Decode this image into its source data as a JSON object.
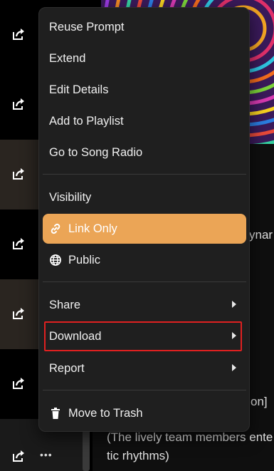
{
  "menu": {
    "items": [
      {
        "label": "Reuse Prompt"
      },
      {
        "label": "Extend"
      },
      {
        "label": "Edit Details"
      },
      {
        "label": "Add to Playlist"
      },
      {
        "label": "Go to Song Radio"
      },
      {
        "label": "Visibility"
      },
      {
        "label": "Link Only",
        "icon": "link-icon",
        "active": true
      },
      {
        "label": "Public",
        "icon": "globe-icon"
      },
      {
        "label": "Share",
        "submenu": true
      },
      {
        "label": "Download",
        "submenu": true
      },
      {
        "label": "Report",
        "submenu": true
      },
      {
        "label": "Move to Trash",
        "icon": "trash-icon"
      }
    ]
  },
  "background": {
    "row_icon": "share-icon",
    "more_label": "•••",
    "right_text": {
      "fragment1": "ynar",
      "fragment2": "on]",
      "line1": "(The lively team members ente",
      "line2": "tic rhythms)"
    }
  },
  "colors": {
    "accent": "#eba556",
    "menu_bg": "#1f1f1f",
    "highlight_border": "#e02020"
  }
}
